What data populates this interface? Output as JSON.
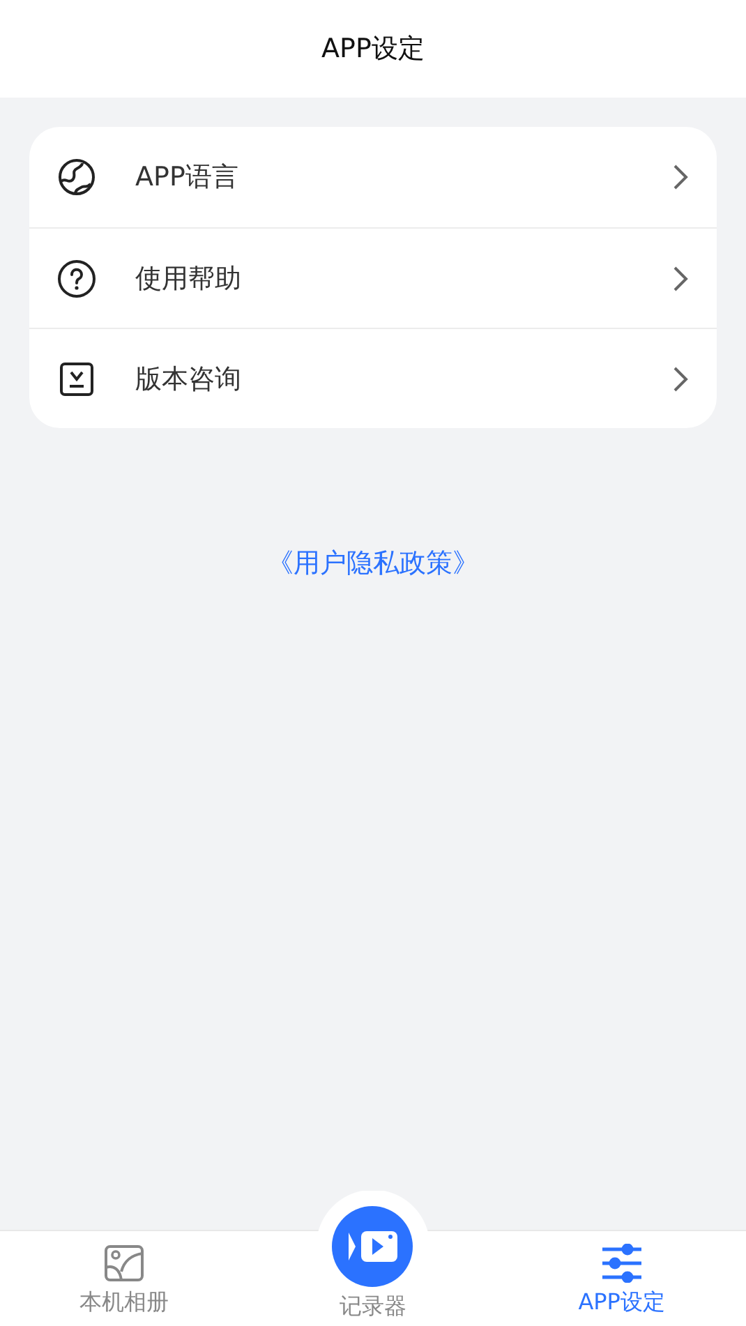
{
  "header": {
    "title": "APP设定"
  },
  "menu": [
    {
      "kind": "globe",
      "label": "APP语言"
    },
    {
      "kind": "help",
      "label": "使用帮助"
    },
    {
      "kind": "version",
      "label": "版本咨询"
    }
  ],
  "privacy_link": "《用户隐私政策》",
  "tabs": [
    {
      "kind": "gallery",
      "label": "本机相册",
      "selected": false
    },
    {
      "kind": "record",
      "label": "记录器",
      "selected": false
    },
    {
      "kind": "settings",
      "label": "APP设定",
      "selected": true
    }
  ]
}
